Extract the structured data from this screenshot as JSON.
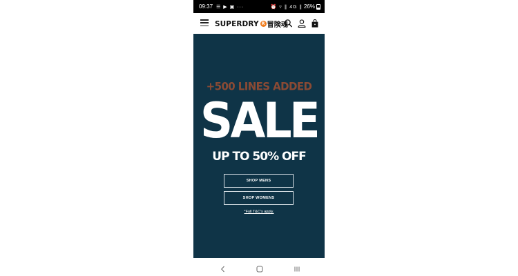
{
  "status_bar": {
    "time": "09:37",
    "notifications": "☰ ▶ ▣ ···",
    "system_icons": "⏰ ▿ ∥ 4G ∥",
    "battery": "26%"
  },
  "header": {
    "brand": "SUPERDRY",
    "brand_reg": "R",
    "brand_jp": "冒険魂"
  },
  "hero": {
    "background": "#0f3447",
    "accent": "#8a4a34",
    "lines_added": "+500 LINES ADDED",
    "headline": "SALE",
    "subheadline": "UP TO 50% OFF",
    "shop_mens": "SHOP MENS",
    "shop_womens": "SHOP WOMENS",
    "terms": "*Full T&C's apply."
  },
  "icons": {
    "menu": "hamburger-icon",
    "search": "search-icon",
    "account": "user-icon",
    "bag": "shopping-bag-icon",
    "nav_back": "back-icon",
    "nav_home": "home-icon",
    "nav_recents": "recents-icon"
  }
}
